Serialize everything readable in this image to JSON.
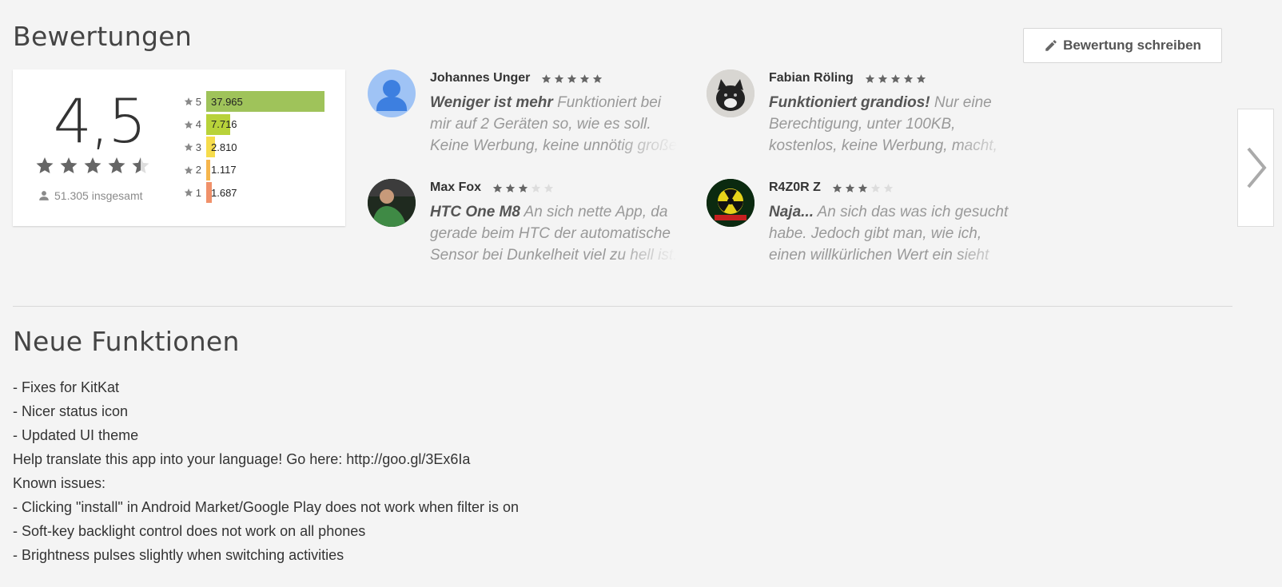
{
  "ratings": {
    "title": "Bewertungen",
    "write_button": "Bewertung schreiben",
    "score": "4,5",
    "score_value": 4.5,
    "total": "51.305 insgesamt",
    "histogram": [
      {
        "stars": "5",
        "count": "37.965",
        "value": 37965,
        "color": "#9fc35a"
      },
      {
        "stars": "4",
        "count": "7.716",
        "value": 7716,
        "color": "#b8d23a"
      },
      {
        "stars": "3",
        "count": "2.810",
        "value": 2810,
        "color": "#f6dc4c"
      },
      {
        "stars": "2",
        "count": "1.117",
        "value": 1117,
        "color": "#f6b64d"
      },
      {
        "stars": "1",
        "count": "1.687",
        "value": 1687,
        "color": "#f0916a"
      }
    ]
  },
  "reviews": [
    {
      "author": "Johannes Unger",
      "rating": 5,
      "title": "Weniger ist mehr",
      "text": " Funktioniert bei mir auf 2 Geräten so, wie es soll. Keine Werbung, keine unnötig große",
      "avatar": "default-user-avatar"
    },
    {
      "author": "Fabian Röling",
      "rating": 5,
      "title": "Funktioniert grandios!",
      "text": " Nur eine Berechtigung, unter 100KB, kostenlos, keine Werbung, macht, was es soll,",
      "avatar": "cat-photo-avatar"
    },
    {
      "author": "Max Fox",
      "rating": 3,
      "title": "HTC One M8",
      "text": " An sich nette App, da gerade beim HTC der automatische Sensor bei Dunkelheit viel zu hell ist.",
      "avatar": "person-photo-avatar"
    },
    {
      "author": "R4Z0R Z",
      "rating": 3,
      "title": "Naja...",
      "text": " An sich das was ich gesucht habe. Jedoch gibt man, wie ich, einen willkürlichen Wert ein sieht man",
      "avatar": "radiation-symbol-avatar"
    }
  ],
  "news": {
    "title": "Neue Funktionen",
    "lines": [
      "- Fixes for KitKat",
      "- Nicer status icon",
      "- Updated UI theme",
      "Help translate this app into your language! Go here: http://goo.gl/3Ex6Ia",
      "Known issues:",
      "- Clicking \"install\" in Android Market/Google Play does not work when filter is on",
      "- Soft-key backlight control does not work on all phones",
      "- Brightness pulses slightly when switching activities"
    ]
  },
  "colors": {
    "star_filled": "#666666",
    "star_empty": "#dddddd",
    "avatar_default": "#9fc3f5"
  }
}
